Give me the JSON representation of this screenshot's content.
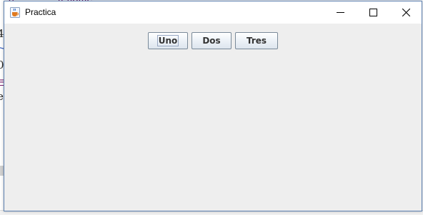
{
  "window": {
    "title": "Practica",
    "icon": "java-cup-icon",
    "controls": {
      "minimize_icon": "minimize-icon",
      "maximize_icon": "maximize-icon",
      "close_icon": "close-icon"
    }
  },
  "buttons": [
    {
      "label": "Uno",
      "focused": true
    },
    {
      "label": "Dos",
      "focused": false
    },
    {
      "label": "Tres",
      "focused": false
    }
  ],
  "background_fragments": [
    "4",
    "~",
    "0",
    "e",
    "F"
  ],
  "colors": {
    "window_border": "#5b7fb0",
    "content_bg": "#eeeeee",
    "titlebar_bg": "#ffffff",
    "button_text": "#333333"
  }
}
